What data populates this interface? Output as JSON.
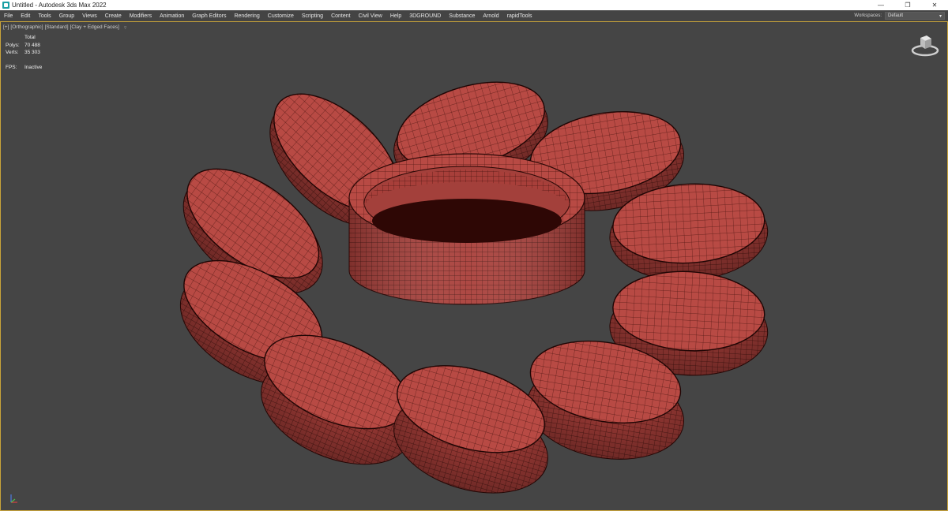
{
  "window": {
    "title": "Untitled - Autodesk 3ds Max 2022",
    "icon": "3dsmax-app-icon",
    "controls": [
      "minimize",
      "restore",
      "close"
    ]
  },
  "menu": {
    "items": [
      "File",
      "Edit",
      "Tools",
      "Group",
      "Views",
      "Create",
      "Modifiers",
      "Animation",
      "Graph Editors",
      "Rendering",
      "Customize",
      "Scripting",
      "Content",
      "Civil View",
      "Help",
      "3DGROUND",
      "Substance",
      "Arnold",
      "rapidTools"
    ],
    "workspaces_label": "Workspaces:",
    "workspace_value": "Default"
  },
  "viewport": {
    "label_parts": [
      "[+]",
      "[Orthographic]",
      "[Standard]",
      "[Clay + Edged Faces]"
    ],
    "stats": {
      "header": "Total",
      "polys_label": "Polys:",
      "polys_value": "70 488",
      "verts_label": "Verts:",
      "verts_value": "35 303",
      "fps_label": "FPS:",
      "fps_value": "Inactive"
    },
    "colors": {
      "background": "#454545",
      "clay": "#b84a44",
      "wire": "#3a0f0c",
      "active_border": "#c8a33a"
    }
  }
}
